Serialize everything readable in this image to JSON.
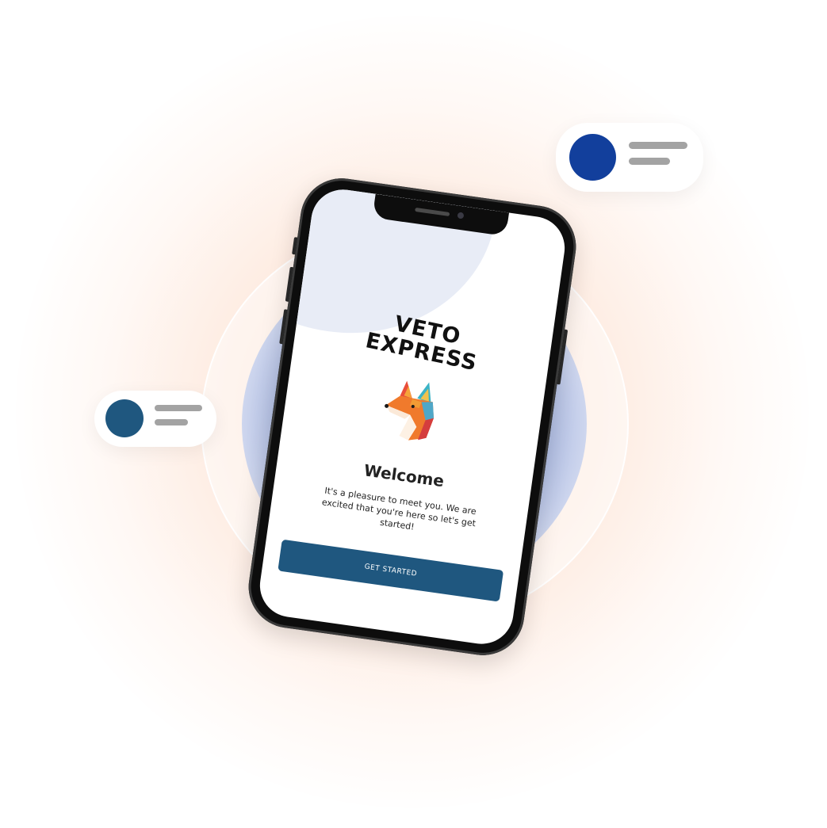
{
  "app": {
    "brand_line1": "VETO",
    "brand_line2": "EXPRESS",
    "logo_icon": "fox-logo-icon"
  },
  "welcome": {
    "title": "Welcome",
    "description": "It's a pleasure to meet you. We are excited that you're here so let's get started!",
    "cta_label": "GET STARTED"
  },
  "colors": {
    "primary_button": "#1f577f",
    "pill_top_dot": "#123f9c",
    "pill_left_dot": "#1f577f",
    "placeholder_line": "#a3a3a3",
    "screen_blob": "#e8ecf6",
    "glow": "#fdd6be"
  }
}
